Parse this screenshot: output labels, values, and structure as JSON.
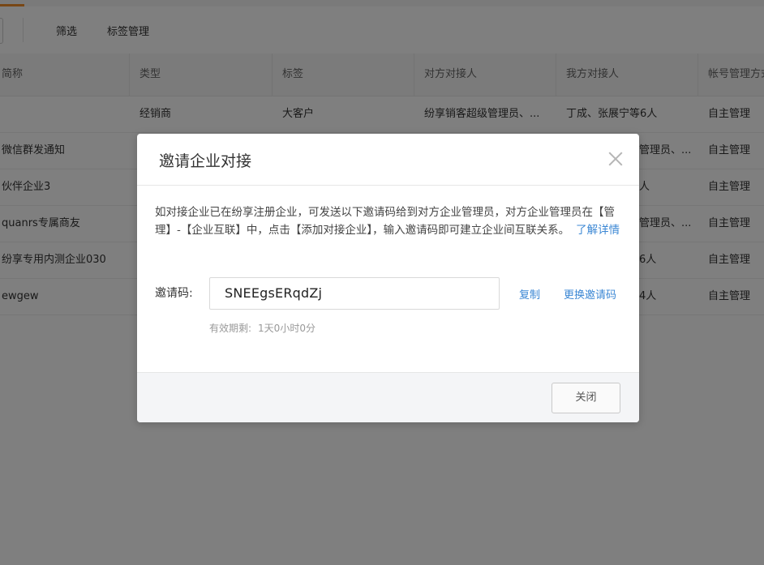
{
  "toolbar": {
    "filter_label": "筛选",
    "tag_manage_label": "标签管理"
  },
  "table": {
    "headers": [
      "简称",
      "类型",
      "标签",
      "对方对接人",
      "我方对接人",
      "帐号管理方式"
    ],
    "rows": [
      [
        "",
        "经销商",
        "大客户",
        "纷享销客超级管理员、...",
        "丁成、张展宁等6人",
        "自主管理"
      ],
      [
        "微信群发通知",
        "",
        "",
        "",
        "管理员、...",
        "自主管理"
      ],
      [
        "伙伴企业3",
        "",
        "",
        "",
        "人",
        "自主管理"
      ],
      [
        "quanrs专属商友",
        "",
        "",
        "",
        "管理员、...",
        "自主管理"
      ],
      [
        "纷享专用内测企业030",
        "",
        "",
        "",
        "6人",
        "自主管理"
      ],
      [
        "ewgew",
        "",
        "",
        "",
        "4人",
        "自主管理"
      ]
    ]
  },
  "modal": {
    "title": "邀请企业对接",
    "description": "如对接企业已在纷享注册企业，可发送以下邀请码给到对方企业管理员，对方企业管理员在【管理】-【企业互联】中，点击【添加对接企业】，输入邀请码即可建立企业间互联关系。",
    "learn_more": "了解详情",
    "code_label": "邀请码:",
    "code_value": "SNEEgsERqdZj",
    "copy_label": "复制",
    "change_label": "更换邀请码",
    "validity_label": "有效期剩:",
    "validity_value": "1天0小时0分",
    "close_button": "关闭"
  },
  "colors": {
    "accent": "#f08e2a",
    "link": "#3b87d4",
    "overlay": "rgba(0,0,0,0.5)"
  }
}
